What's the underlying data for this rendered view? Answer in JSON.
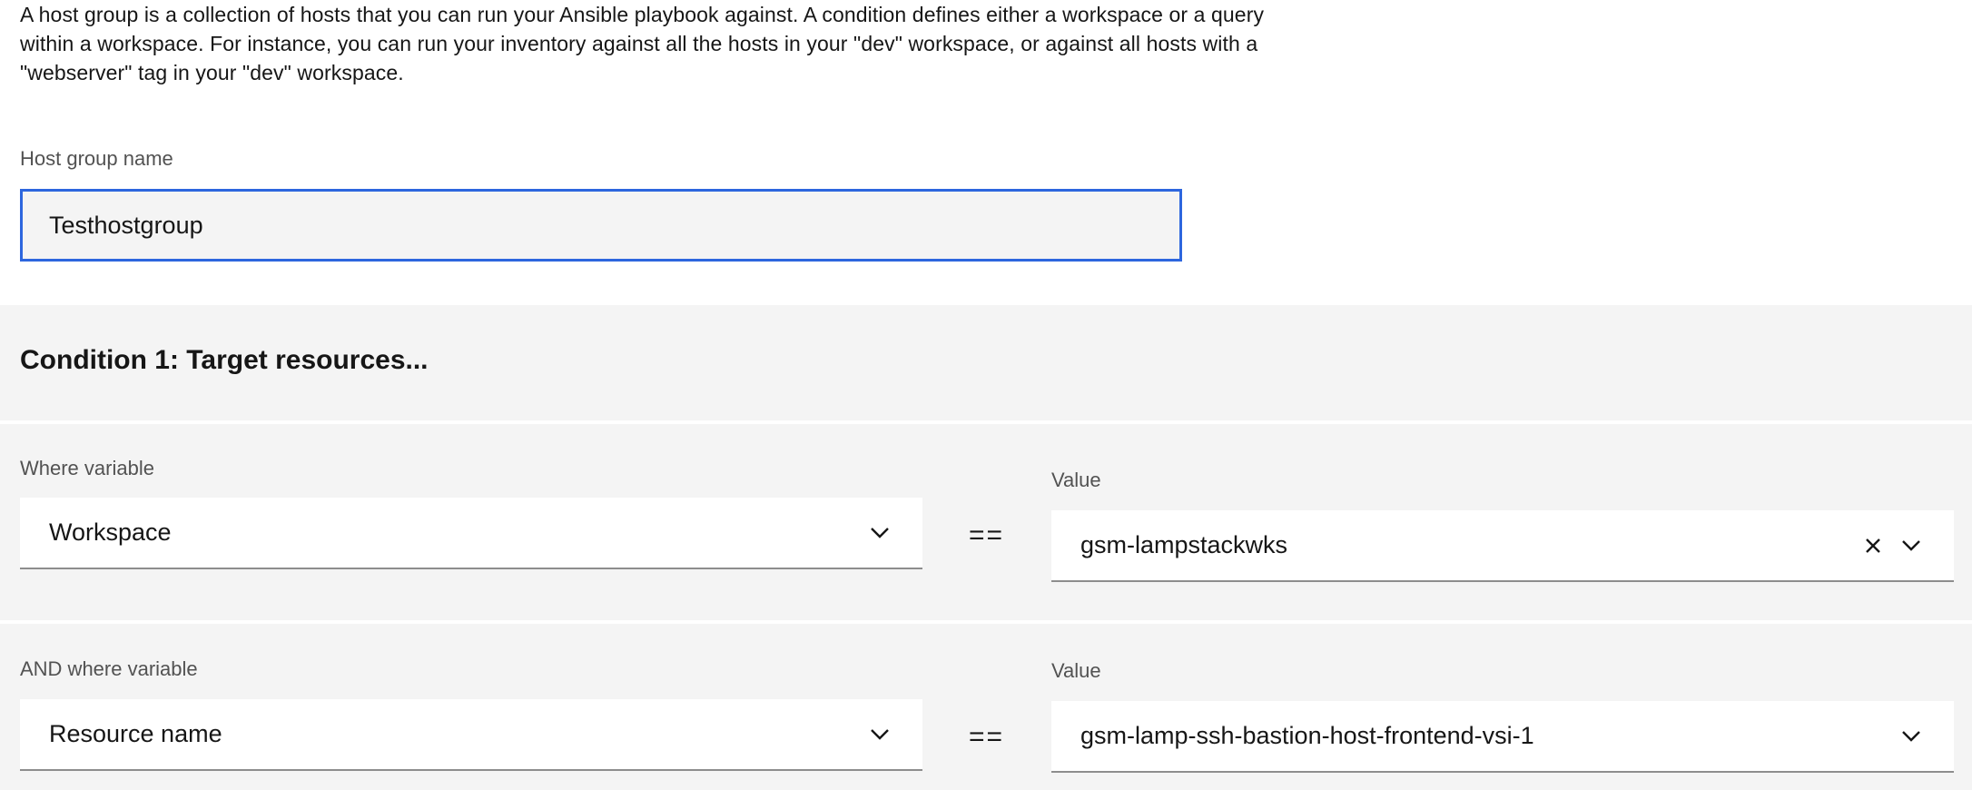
{
  "intro": {
    "text": "A host group is a collection of hosts that you can run your Ansible playbook against. A condition defines either a workspace or a query within a workspace. For instance, you can run your inventory against all the hosts in your \"dev\" workspace, or against all hosts with a \"webserver\" tag in your \"dev\" workspace."
  },
  "host_group": {
    "label": "Host group name",
    "value": "Testhostgroup"
  },
  "condition": {
    "title": "Condition 1: Target resources...",
    "rows": [
      {
        "variable_label": "Where variable",
        "variable_value": "Workspace",
        "operator": "==",
        "value_label": "Value",
        "value": "gsm-lampstackwks"
      },
      {
        "variable_label": "AND where variable",
        "variable_value": "Resource name",
        "operator": "==",
        "value_label": "Value",
        "value": "gsm-lamp-ssh-bastion-host-frontend-vsi-1"
      }
    ]
  },
  "colors": {
    "focus_border": "#2d66de",
    "panel_bg": "#f4f4f4",
    "label_text": "#525252"
  }
}
